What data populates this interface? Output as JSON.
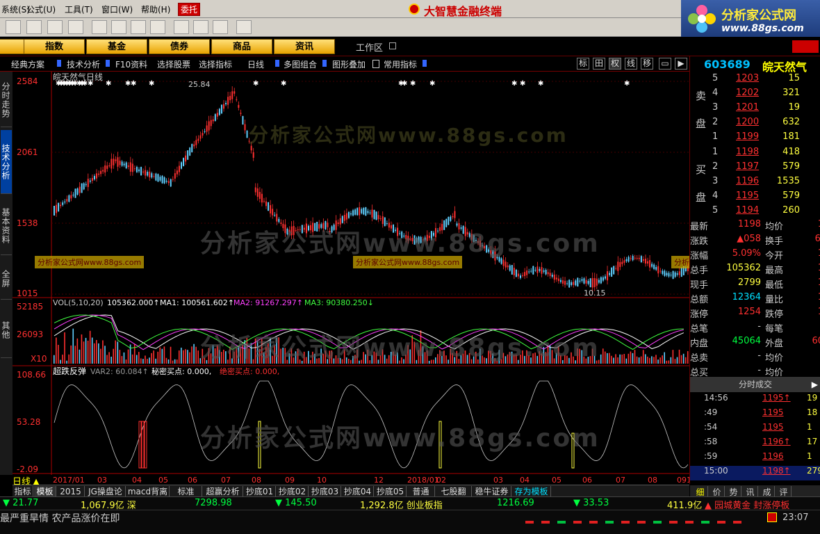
{
  "menu": {
    "items": [
      "系统(S)",
      "公式(U)",
      "工具(T)",
      "窗口(W)",
      "帮助(H)"
    ],
    "entrust": "委托",
    "brand": "大智慧金融终端"
  },
  "logo": {
    "title": "分析家公式网",
    "url": "www.88gs.com"
  },
  "nav": {
    "buttons": [
      "指数",
      "基金",
      "债券",
      "商品",
      "资讯"
    ],
    "workarea": "工作区"
  },
  "subbar": {
    "items": [
      "经典方案",
      "技术分析",
      "F10资料",
      "选择股票",
      "选择指标",
      "日线",
      "多图组合",
      "图形叠加",
      "常用指标"
    ],
    "icons": [
      "标",
      "田",
      "权",
      "线",
      "移",
      "▭",
      "▶"
    ]
  },
  "lefttabs": [
    "分时走势",
    "技术分析",
    "基本资料",
    "全屏",
    "其他"
  ],
  "chart": {
    "name": "皖天然气日线",
    "price_axis": [
      "2584",
      "2061",
      "1538",
      "1015"
    ],
    "peak_label": "25.84",
    "low_label": "10.15",
    "vol_axis": [
      "52185",
      "26093",
      "X10"
    ],
    "vol_label": "VOL(5,10,20)",
    "vol_value": "105362.000↑",
    "ma1": "MA1: 100561.602↑",
    "ma2": "MA2: 91267.297↑",
    "ma3": "MA3: 90380.250↓",
    "ind_axis": [
      "108.66",
      "53.28",
      "-2.09"
    ],
    "ind_name": "超跌反弹",
    "ind_var2": "VAR2: 60.084↑",
    "ind_secret": "秘密买点: 0.000,",
    "ind_absolute": "绝密买点: 0.000,",
    "watermark": "分析家公式网www.88gs.com",
    "watermark_small": "分析家公式网www.88gs.com",
    "x_axis": [
      "2017/01",
      "03",
      "04",
      "05",
      "06",
      "07",
      "08",
      "09",
      "10",
      "12",
      "2018/01",
      "02",
      "03",
      "04",
      "05",
      "06",
      "07",
      "08",
      "09",
      "10"
    ]
  },
  "right": {
    "code": "603689",
    "name": "皖天然气",
    "sell_label": [
      "卖",
      "盘"
    ],
    "buy_label": [
      "买",
      "盘"
    ],
    "sell": [
      {
        "i": "5",
        "p": "1203",
        "v": "15"
      },
      {
        "i": "4",
        "p": "1202",
        "v": "321"
      },
      {
        "i": "3",
        "p": "1201",
        "v": "19"
      },
      {
        "i": "2",
        "p": "1200",
        "v": "632"
      },
      {
        "i": "1",
        "p": "1199",
        "v": "181"
      }
    ],
    "buy": [
      {
        "i": "1",
        "p": "1198",
        "v": "418"
      },
      {
        "i": "2",
        "p": "1197",
        "v": "579"
      },
      {
        "i": "3",
        "p": "1196",
        "v": "1535"
      },
      {
        "i": "4",
        "p": "1195",
        "v": "579"
      },
      {
        "i": "5",
        "p": "1194",
        "v": "260"
      }
    ],
    "stats": [
      {
        "k1": "最新",
        "v1": "1198",
        "c1": "#ff3030",
        "k2": "均价",
        "v2": "1"
      },
      {
        "k1": "涨跌",
        "v1": "▲058",
        "c1": "#ff3030",
        "k2": "换手",
        "v2": "6."
      },
      {
        "k1": "涨幅",
        "v1": "5.09%",
        "c1": "#ff3030",
        "k2": "今开",
        "v2": "1"
      },
      {
        "k1": "总手",
        "v1": "105362",
        "c1": "#ffff40",
        "k2": "最高",
        "v2": "1"
      },
      {
        "k1": "现手",
        "v1": "2799",
        "c1": "#ffff40",
        "k2": "最低",
        "v2": "1"
      },
      {
        "k1": "总额",
        "v1": "12364",
        "c1": "#00e0ff",
        "k2": "量比",
        "v2": "1"
      },
      {
        "k1": "涨停",
        "v1": "1254",
        "c1": "#ff3030",
        "k2": "跌停",
        "v2": "1"
      },
      {
        "k1": "总笔",
        "v1": "-",
        "c1": "#ccc",
        "k2": "每笔",
        "v2": ""
      },
      {
        "k1": "内盘",
        "v1": "45064",
        "c1": "#00ff40",
        "k2": "外盘",
        "v2": "60"
      },
      {
        "k1": "总卖",
        "v1": "-",
        "c1": "#ccc",
        "k2": "均价",
        "v2": ""
      },
      {
        "k1": "总买",
        "v1": "-",
        "c1": "#ccc",
        "k2": "均价",
        "v2": ""
      }
    ],
    "trades_head": "分时成交",
    "trades": [
      {
        "t": "14:56",
        "p": "1195↑",
        "v": "19"
      },
      {
        "t": ":49",
        "p": "1195",
        "v": "18"
      },
      {
        "t": ":54",
        "p": "1195",
        "v": "1"
      },
      {
        "t": ":58",
        "p": "1196↑",
        "v": "17"
      },
      {
        "t": ":59",
        "p": "1196",
        "v": "1"
      },
      {
        "t": "15:00",
        "p": "1198↑",
        "v": "279"
      }
    ],
    "rtabs": [
      "细",
      "价",
      "势",
      "讯",
      "成",
      "评"
    ]
  },
  "bottomtabs": [
    "指标",
    "模板",
    "2015",
    "JG操盘论",
    "macd背离",
    "标准",
    "超赢分析",
    "抄底01",
    "抄底02",
    "抄底03",
    "抄底04",
    "抄底05",
    "普通",
    "七股翻",
    "稳牛证券",
    "存为模板"
  ],
  "daybar": "日线",
  "status1": [
    {
      "t": "▼ 21.77",
      "c": "#00ff40"
    },
    {
      "t": "1,067.9亿 深",
      "c": "#ffff40"
    },
    {
      "t": "7298.98",
      "c": "#00ff40"
    },
    {
      "t": "▼ 145.50",
      "c": "#00ff40"
    },
    {
      "t": "1,292.8亿 创业板指",
      "c": "#ffff40"
    },
    {
      "t": "1216.69",
      "c": "#00ff40"
    },
    {
      "t": "▼ 33.53",
      "c": "#00ff40"
    },
    {
      "t": "411.9亿",
      "c": "#ffff40"
    },
    {
      "t": "▲ 园城黄金 封涨停板",
      "c": "#ff3030"
    }
  ],
  "status2": {
    "news": "最严重旱情 农产品涨价在即",
    "time": "23:07"
  }
}
